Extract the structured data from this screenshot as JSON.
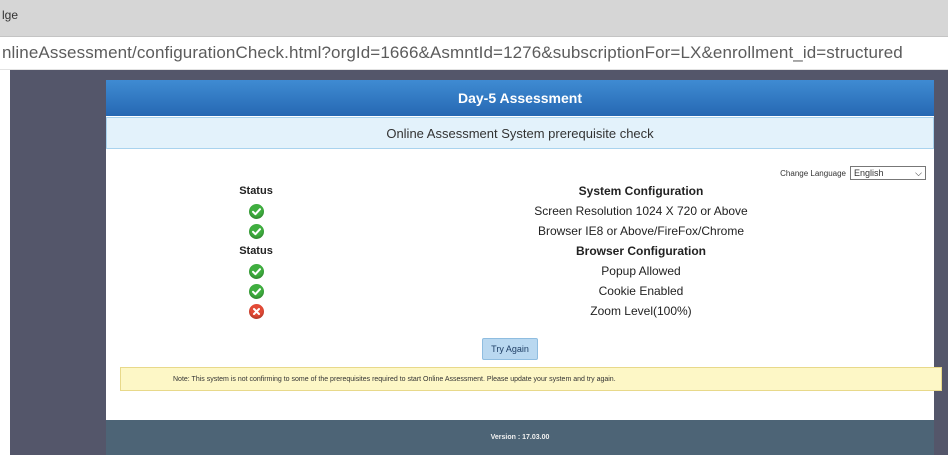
{
  "browser": {
    "title_fragment": "lge",
    "url": "nlineAssessment/configurationCheck.html?orgId=1666&AsmntId=1276&subscriptionFor=LX&enrollment_id=structured"
  },
  "card": {
    "header": "Day-5 Assessment",
    "subheader": "Online Assessment System prerequisite check",
    "language": {
      "label": "Change Language",
      "selected": "English"
    },
    "system": {
      "status_label": "Status",
      "section_label": "System Configuration",
      "items": [
        {
          "label": "Screen Resolution 1024 X 720 or Above",
          "status": "ok"
        },
        {
          "label": "Browser IE8 or Above/FireFox/Chrome",
          "status": "ok"
        }
      ]
    },
    "browser_config": {
      "status_label": "Status",
      "section_label": "Browser Configuration",
      "items": [
        {
          "label": "Popup Allowed",
          "status": "ok"
        },
        {
          "label": "Cookie Enabled",
          "status": "ok"
        },
        {
          "label": "Zoom Level(100%)",
          "status": "fail"
        }
      ]
    },
    "try_again": "Try Again",
    "note": "Note:  This system is not confirming to some of the prerequisites required to start Online Assessment. Please update your system and try again.",
    "version": "Version : 17.03.00"
  },
  "colors": {
    "header_blue": "#2e76c2",
    "ok_green": "#3fae3f",
    "fail_red": "#e24a36",
    "note_yellow": "#fdf7c6",
    "footer": "#4d6476",
    "page_backdrop": "#54566a"
  },
  "icons": {
    "ok": "check-circle-icon",
    "fail": "x-circle-icon",
    "select": "chevron-down-icon"
  }
}
